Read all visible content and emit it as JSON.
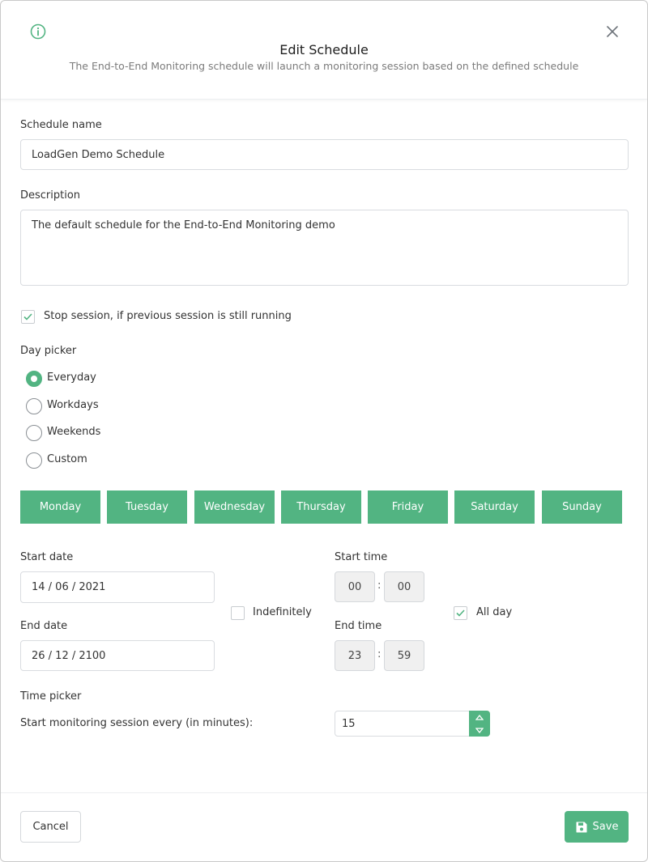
{
  "header": {
    "title": "Edit Schedule",
    "subtitle": "The End-to-End Monitoring schedule will launch a monitoring session based on the defined schedule",
    "info_icon": "info-circle-icon",
    "close_icon": "close-x-icon"
  },
  "form": {
    "schedule_name_label": "Schedule name",
    "schedule_name_value": "LoadGen Demo Schedule",
    "description_label": "Description",
    "description_value": "The default schedule for the End-to-End Monitoring demo",
    "stop_session_label": "Stop session, if previous session is still running",
    "stop_session_checked": true,
    "day_picker_label": "Day picker",
    "day_picker_options": [
      {
        "label": "Everyday",
        "selected": true
      },
      {
        "label": "Workdays",
        "selected": false
      },
      {
        "label": "Weekends",
        "selected": false
      },
      {
        "label": "Custom",
        "selected": false
      }
    ],
    "days": [
      "Monday",
      "Tuesday",
      "Wednesday",
      "Thursday",
      "Friday",
      "Saturday",
      "Sunday"
    ],
    "start_date_label": "Start date",
    "start_date_value": "14 / 06 / 2021",
    "end_date_label": "End date",
    "end_date_value": "26 / 12 / 2100",
    "indefinitely_label": "Indefinitely",
    "indefinitely_checked": false,
    "start_time_label": "Start time",
    "start_time_hours": "00",
    "start_time_minutes": "00",
    "end_time_label": "End time",
    "end_time_hours": "23",
    "end_time_minutes": "59",
    "time_separator": ":",
    "all_day_label": "All day",
    "all_day_checked": true,
    "time_picker_label": "Time picker",
    "interval_label": "Start monitoring session every (in minutes):",
    "interval_value": "15"
  },
  "footer": {
    "cancel_label": "Cancel",
    "save_label": "Save",
    "save_icon": "floppy-disk-icon"
  },
  "colors": {
    "accent": "#52b482",
    "border": "#d9dce0",
    "text": "#333333",
    "muted": "#7b7b7b"
  }
}
